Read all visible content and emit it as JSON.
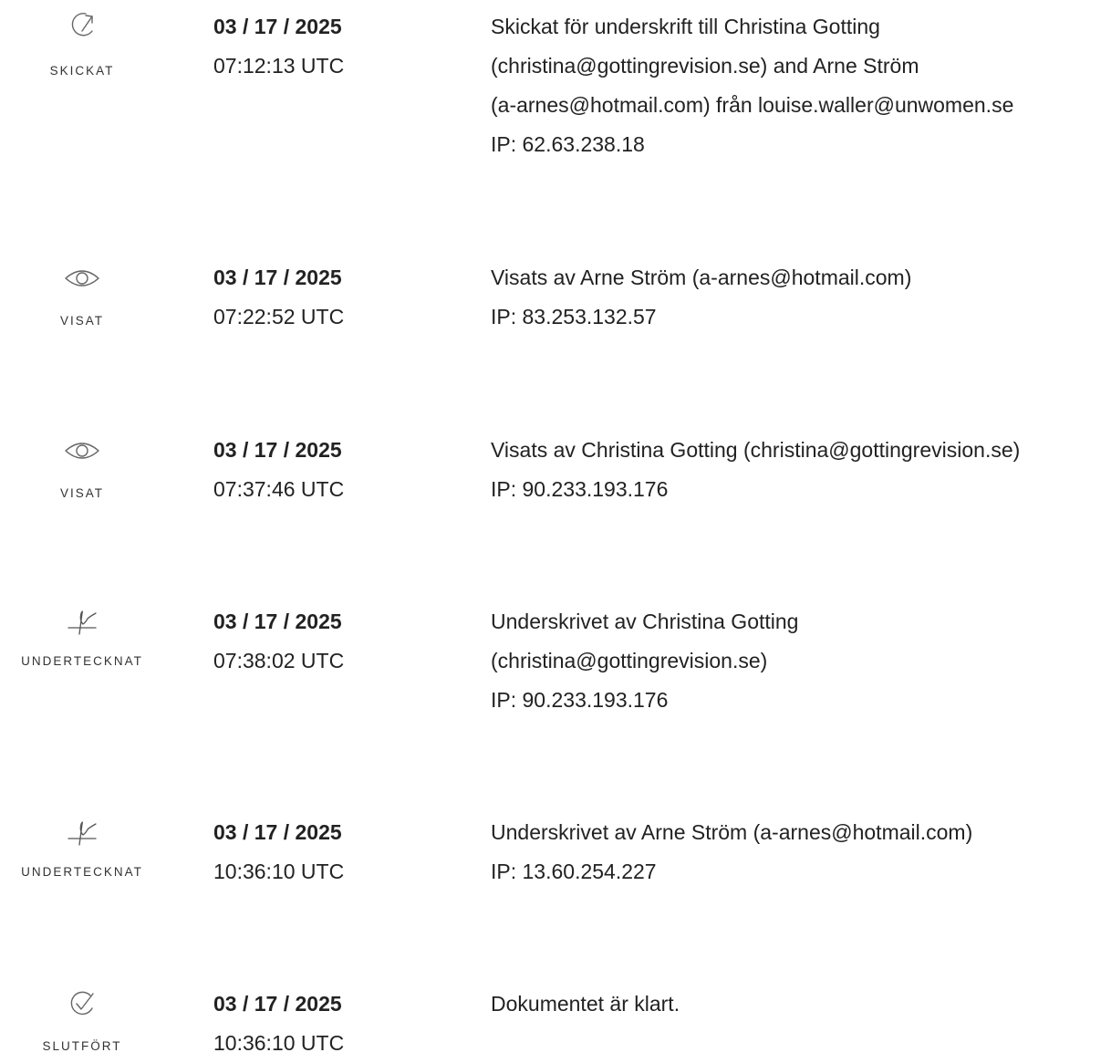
{
  "entries": [
    {
      "status": "SKICKAT",
      "icon": "send-arrow-icon",
      "date": "03 / 17 / 2025",
      "time": "07:12:13 UTC",
      "lines": [
        "Skickat för underskrift till Christina Gotting",
        "(christina@gottingrevision.se) and Arne Ström",
        "(a-arnes@hotmail.com) från louise.waller@unwomen.se",
        "IP: 62.63.238.18"
      ]
    },
    {
      "status": "VISAT",
      "icon": "eye-icon",
      "date": "03 / 17 / 2025",
      "time": "07:22:52 UTC",
      "lines": [
        "Visats av Arne Ström (a-arnes@hotmail.com)",
        "IP: 83.253.132.57"
      ]
    },
    {
      "status": "VISAT",
      "icon": "eye-icon",
      "date": "03 / 17 / 2025",
      "time": "07:37:46 UTC",
      "lines": [
        "Visats av Christina Gotting (christina@gottingrevision.se)",
        "IP: 90.233.193.176"
      ]
    },
    {
      "status": "UNDERTECKNAT",
      "icon": "signature-icon",
      "date": "03 / 17 / 2025",
      "time": "07:38:02 UTC",
      "lines": [
        "Underskrivet av Christina Gotting",
        "(christina@gottingrevision.se)",
        "IP: 90.233.193.176"
      ]
    },
    {
      "status": "UNDERTECKNAT",
      "icon": "signature-icon",
      "date": "03 / 17 / 2025",
      "time": "10:36:10 UTC",
      "lines": [
        "Underskrivet av Arne Ström (a-arnes@hotmail.com)",
        "IP: 13.60.254.227"
      ]
    },
    {
      "status": "SLUTFÖRT",
      "icon": "check-circle-icon",
      "date": "03 / 17 / 2025",
      "time": "10:36:10 UTC",
      "lines": [
        "Dokumentet är klart."
      ]
    }
  ]
}
